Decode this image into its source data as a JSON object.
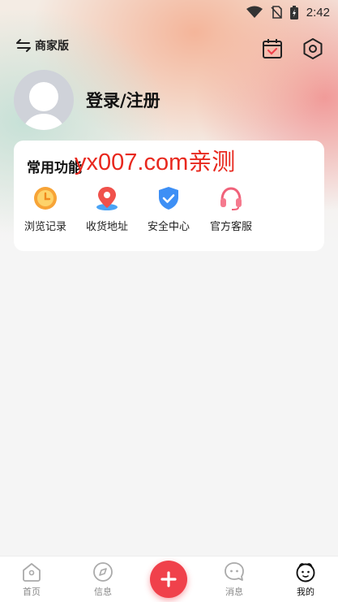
{
  "status_bar": {
    "time": "2:42"
  },
  "header": {
    "merchant_label": "商家版"
  },
  "profile": {
    "login_label": "登录/注册"
  },
  "functions": {
    "title": "常用功能",
    "watermark": "yx007.com亲测",
    "items": [
      {
        "label": "浏览记录",
        "icon": "history-clock-icon"
      },
      {
        "label": "收货地址",
        "icon": "location-pin-icon"
      },
      {
        "label": "安全中心",
        "icon": "security-shield-icon"
      },
      {
        "label": "官方客服",
        "icon": "headset-icon"
      }
    ]
  },
  "tabbar": {
    "tabs": [
      {
        "label": "首页",
        "icon": "home-icon"
      },
      {
        "label": "信息",
        "icon": "compass-icon"
      },
      {
        "label": "消息",
        "icon": "chat-icon"
      },
      {
        "label": "我的",
        "icon": "face-icon",
        "active": true
      }
    ],
    "fab_icon": "plus-icon"
  },
  "colors": {
    "accent": "#f0414b",
    "watermark": "#e8281e",
    "shield": "#3d8ff5"
  }
}
